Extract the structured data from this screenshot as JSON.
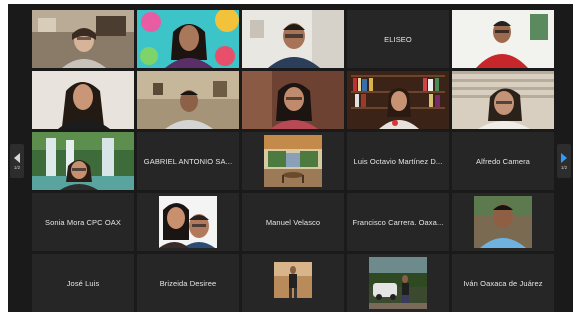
{
  "navigation": {
    "prev_page_label": "1/2",
    "next_page_label": "1/2"
  },
  "participants": {
    "eliseo": "ELISEO",
    "gabriel": "GABRIEL ANTONIO SA...",
    "luis_octavio": "Luis Octavio Martínez D...",
    "alfredo": "Alfredo Camera",
    "sonia": "Sonia Mora CPC OAX",
    "manuel": "Manuel Velasco",
    "francisco": "Francisco Carrera. Oaxa...",
    "jose_luis": "José Luis",
    "brizeida": "Brizeida Desiree",
    "ivan": "Iván Oaxaca de Juárez"
  },
  "colors": {
    "tile_background": "#262626",
    "frame_background": "#1a1a1a",
    "active_speaker_border": "#4aa44a",
    "next_arrow": "#2e9bff"
  }
}
